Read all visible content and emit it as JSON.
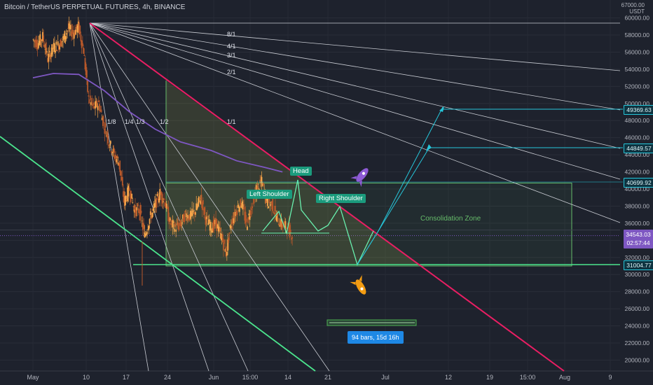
{
  "header": {
    "title": "Bitcoin / TetherUS PERPETUAL FUTURES, 4h, BINANCE",
    "currency_top": "67000.00",
    "currency": "USDT"
  },
  "price_tags": {
    "t1": "49369.63",
    "t2": "44849.57",
    "t3": "40699.92",
    "current": "34543.03",
    "countdown": "02:57:44",
    "bottom": "31004.77"
  },
  "annotations": {
    "head": "Head",
    "left_shoulder": "Left Shoulder",
    "right_shoulder": "Right Shoulder",
    "consolidation": "Consolidation Zone",
    "measure": "94 bars, 15d 16h"
  },
  "gann_labels": [
    "8/1",
    "4/1",
    "3/1",
    "2/1",
    "1/1",
    "1/2",
    "1/3",
    "1/4",
    "1/8"
  ],
  "colors": {
    "background": "#1e222d",
    "up_candle": "#f7a64a",
    "down_candle": "#b8582a",
    "ma_line": "#7e57c2",
    "descending_trendline": "#e91e63",
    "ascending_trendline": "#4be58d",
    "consolidation_box": "#66bb6a",
    "projection": "#26c6da"
  },
  "chart_data": {
    "type": "candlestick",
    "title": "Bitcoin / TetherUS PERPETUAL FUTURES, 4h, BINANCE",
    "y_axis": {
      "ticks": [
        60000,
        58000,
        56000,
        54000,
        52000,
        50000,
        48000,
        46000,
        44000,
        42000,
        40000,
        38000,
        36000,
        34000,
        32000,
        30000,
        28000,
        26000,
        24000,
        22000,
        20000
      ],
      "tick_labels": [
        "60000.00",
        "58000.00",
        "56000.00",
        "54000.00",
        "52000.00",
        "50000.00",
        "48000.00",
        "46000.00",
        "44000.00",
        "42000.00",
        "40000.00",
        "38000.00",
        "36000.00",
        "34000.00",
        "32000.00",
        "30000.00",
        "28000.00",
        "26000.00",
        "24000.00",
        "22000.00",
        "20000.00"
      ],
      "ylim": [
        19000,
        62000
      ]
    },
    "x_axis": {
      "tick_labels": [
        "May",
        "10",
        "17",
        "24",
        "Jun",
        "15:00",
        "14",
        "21",
        "Jul",
        "12",
        "19",
        "15:00",
        "Aug",
        "9"
      ]
    },
    "price_path": [
      [
        "2021-05-01",
        57500
      ],
      [
        "2021-05-02",
        57000
      ],
      [
        "2021-05-03",
        57800
      ],
      [
        "2021-05-04",
        55200
      ],
      [
        "2021-05-05",
        56500
      ],
      [
        "2021-05-06",
        56800
      ],
      [
        "2021-05-07",
        57500
      ],
      [
        "2021-05-08",
        58800
      ],
      [
        "2021-05-09",
        58200
      ],
      [
        "2021-05-10",
        59000
      ],
      [
        "2021-05-11",
        56200
      ],
      [
        "2021-05-12",
        50500
      ],
      [
        "2021-05-13",
        49500
      ],
      [
        "2021-05-14",
        50000
      ],
      [
        "2021-05-15",
        47500
      ],
      [
        "2021-05-16",
        45500
      ],
      [
        "2021-05-17",
        44000
      ],
      [
        "2021-05-18",
        43000
      ],
      [
        "2021-05-19",
        38500
      ],
      [
        "2021-05-20",
        40000
      ],
      [
        "2021-05-21",
        37500
      ],
      [
        "2021-05-22",
        37500
      ],
      [
        "2021-05-23",
        34500
      ],
      [
        "2021-05-24",
        36500
      ],
      [
        "2021-05-25",
        38000
      ],
      [
        "2021-05-26",
        39500
      ],
      [
        "2021-05-27",
        38500
      ],
      [
        "2021-05-28",
        36000
      ],
      [
        "2021-05-29",
        35500
      ],
      [
        "2021-05-30",
        35800
      ],
      [
        "2021-05-31",
        37000
      ],
      [
        "2021-06-01",
        36800
      ],
      [
        "2021-06-02",
        37500
      ],
      [
        "2021-06-03",
        39000
      ],
      [
        "2021-06-04",
        36500
      ],
      [
        "2021-06-05",
        35500
      ],
      [
        "2021-06-06",
        36000
      ],
      [
        "2021-06-07",
        34500
      ],
      [
        "2021-06-08",
        32500
      ],
      [
        "2021-06-09",
        36000
      ],
      [
        "2021-06-10",
        37500
      ],
      [
        "2021-06-11",
        38500
      ],
      [
        "2021-06-12",
        35800
      ],
      [
        "2021-06-13",
        38000
      ],
      [
        "2021-06-14",
        40000
      ],
      [
        "2021-06-15",
        40800
      ],
      [
        "2021-06-16",
        38500
      ],
      [
        "2021-06-17",
        38200
      ],
      [
        "2021-06-18",
        36500
      ],
      [
        "2021-06-19",
        35800
      ],
      [
        "2021-06-20",
        35500
      ],
      [
        "2021-06-21",
        34540
      ]
    ],
    "moving_average": [
      [
        "2021-05-01",
        53000
      ],
      [
        "2021-05-05",
        53500
      ],
      [
        "2021-05-10",
        53400
      ],
      [
        "2021-05-15",
        51500
      ],
      [
        "2021-05-20",
        49000
      ],
      [
        "2021-05-25",
        47000
      ],
      [
        "2021-05-30",
        45500
      ],
      [
        "2021-06-05",
        44500
      ],
      [
        "2021-06-10",
        43300
      ],
      [
        "2021-06-15",
        42600
      ],
      [
        "2021-06-19",
        42000
      ]
    ],
    "consolidation_zone": {
      "top": 40700,
      "bottom": 31000,
      "from": "2021-05-24",
      "to": "2021-08-01"
    },
    "pattern": "head and shoulders",
    "projection_targets": [
      44849.57,
      49369.63
    ]
  }
}
